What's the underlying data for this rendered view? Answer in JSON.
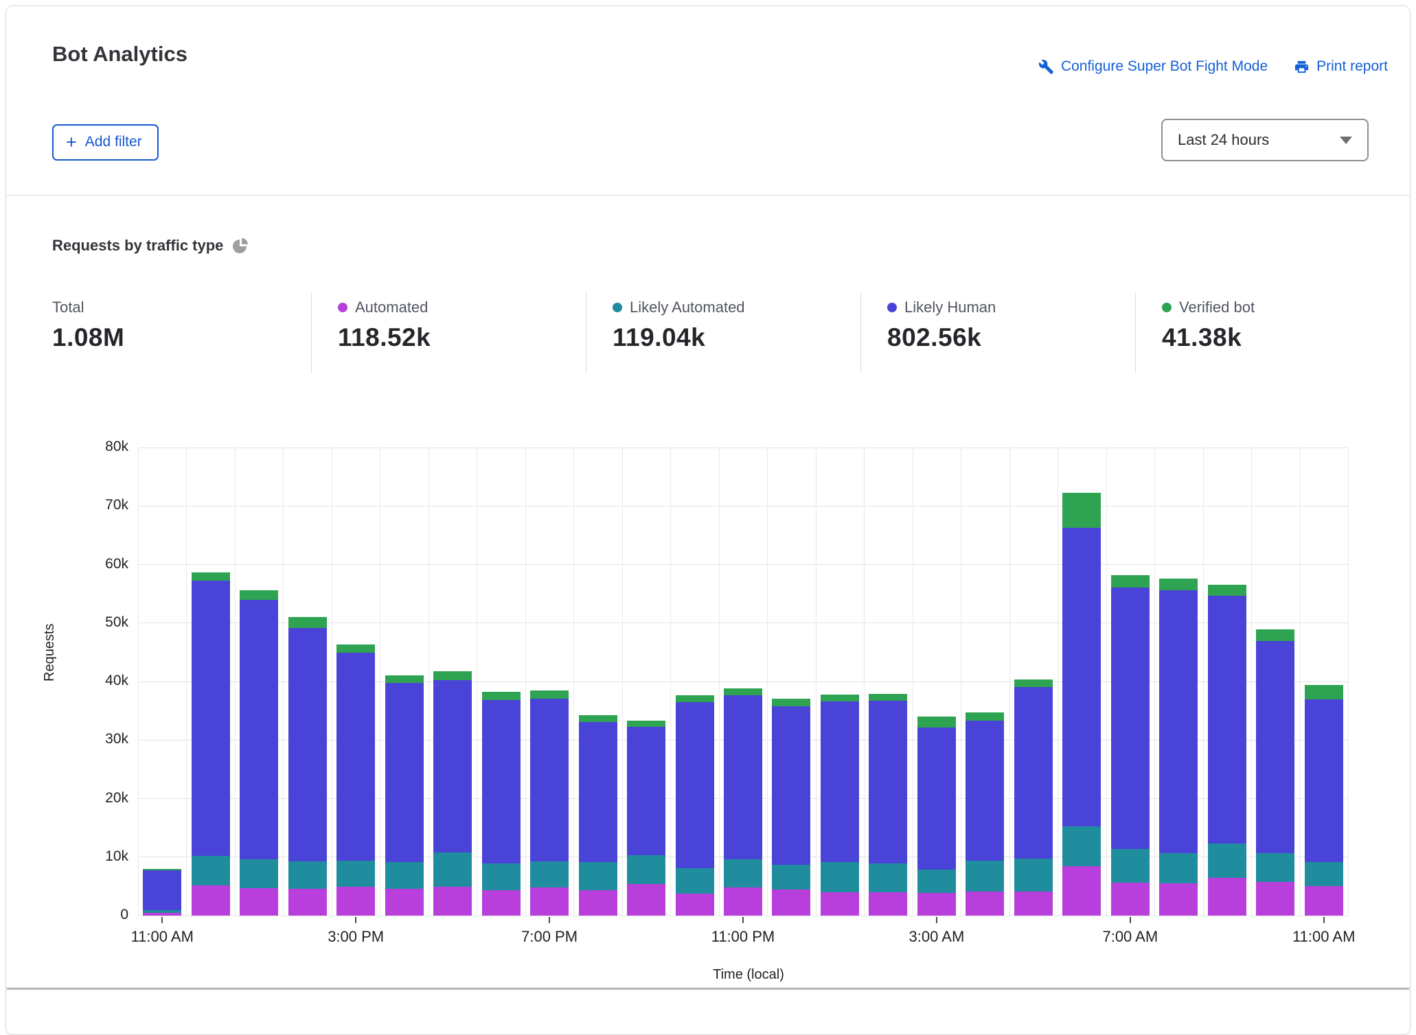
{
  "header": {
    "title": "Bot Analytics",
    "configure_link": "Configure Super Bot Fight Mode",
    "print_link": "Print report",
    "add_filter_label": "Add filter",
    "time_range_value": "Last 24 hours"
  },
  "section": {
    "title": "Requests by traffic type"
  },
  "stats": {
    "items": [
      {
        "label": "Total",
        "value": "1.08M",
        "color": null
      },
      {
        "label": "Automated",
        "value": "118.52k",
        "color": "#b83fdc"
      },
      {
        "label": "Likely Automated",
        "value": "119.04k",
        "color": "#1f8d9e"
      },
      {
        "label": "Likely Human",
        "value": "802.56k",
        "color": "#4a43d8"
      },
      {
        "label": "Verified bot",
        "value": "41.38k",
        "color": "#2ea352"
      }
    ]
  },
  "chart_data": {
    "type": "bar",
    "stacked": true,
    "title": "Requests by traffic type",
    "xlabel": "Time (local)",
    "ylabel": "Requests",
    "ylim": [
      0,
      80000
    ],
    "grid": true,
    "y_tick_labels": [
      "0",
      "10k",
      "20k",
      "30k",
      "40k",
      "50k",
      "60k",
      "70k",
      "80k"
    ],
    "x_tick_positions": [
      0,
      4,
      8,
      12,
      16,
      20,
      24
    ],
    "x_tick_labels": [
      "11:00 AM",
      "3:00 PM",
      "7:00 PM",
      "11:00 PM",
      "3:00 AM",
      "7:00 AM",
      "11:00 AM"
    ],
    "series_names": [
      "Automated",
      "Likely Automated",
      "Likely Human",
      "Verified bot"
    ],
    "colors": {
      "automated": "#b83fdc",
      "likely_automated": "#1f8d9e",
      "likely_human": "#4a43d8",
      "verified_bot": "#2ea352"
    },
    "bars": [
      {
        "time": "11:00 AM",
        "automated": 500,
        "likely_automated": 500,
        "likely_human": 6700,
        "verified_bot": 300
      },
      {
        "time": "12:00 PM",
        "automated": 5200,
        "likely_automated": 5000,
        "likely_human": 47000,
        "verified_bot": 1400
      },
      {
        "time": "1:00 PM",
        "automated": 4700,
        "likely_automated": 4900,
        "likely_human": 44400,
        "verified_bot": 1600
      },
      {
        "time": "2:00 PM",
        "automated": 4600,
        "likely_automated": 4700,
        "likely_human": 39900,
        "verified_bot": 1800
      },
      {
        "time": "3:00 PM",
        "automated": 4900,
        "likely_automated": 4500,
        "likely_human": 35500,
        "verified_bot": 1400
      },
      {
        "time": "4:00 PM",
        "automated": 4600,
        "likely_automated": 4600,
        "likely_human": 30600,
        "verified_bot": 1300
      },
      {
        "time": "5:00 PM",
        "automated": 4900,
        "likely_automated": 5900,
        "likely_human": 29400,
        "verified_bot": 1600
      },
      {
        "time": "6:00 PM",
        "automated": 4400,
        "likely_automated": 4500,
        "likely_human": 27900,
        "verified_bot": 1400
      },
      {
        "time": "7:00 PM",
        "automated": 4800,
        "likely_automated": 4500,
        "likely_human": 27800,
        "verified_bot": 1400
      },
      {
        "time": "8:00 PM",
        "automated": 4400,
        "likely_automated": 4800,
        "likely_human": 23900,
        "verified_bot": 1100
      },
      {
        "time": "9:00 PM",
        "automated": 5400,
        "likely_automated": 4900,
        "likely_human": 22000,
        "verified_bot": 1000
      },
      {
        "time": "10:00 PM",
        "automated": 3800,
        "likely_automated": 4300,
        "likely_human": 28400,
        "verified_bot": 1200
      },
      {
        "time": "11:00 PM",
        "automated": 4800,
        "likely_automated": 4800,
        "likely_human": 28100,
        "verified_bot": 1100
      },
      {
        "time": "12:00 AM",
        "automated": 4500,
        "likely_automated": 4200,
        "likely_human": 27100,
        "verified_bot": 1300
      },
      {
        "time": "1:00 AM",
        "automated": 4000,
        "likely_automated": 5100,
        "likely_human": 27500,
        "verified_bot": 1200
      },
      {
        "time": "2:00 AM",
        "automated": 4000,
        "likely_automated": 4900,
        "likely_human": 27800,
        "verified_bot": 1200
      },
      {
        "time": "3:00 AM",
        "automated": 3900,
        "likely_automated": 4000,
        "likely_human": 24300,
        "verified_bot": 1800
      },
      {
        "time": "4:00 AM",
        "automated": 4100,
        "likely_automated": 5300,
        "likely_human": 23900,
        "verified_bot": 1400
      },
      {
        "time": "5:00 AM",
        "automated": 4100,
        "likely_automated": 5600,
        "likely_human": 29400,
        "verified_bot": 1300
      },
      {
        "time": "6:00 AM",
        "automated": 8500,
        "likely_automated": 6700,
        "likely_human": 51100,
        "verified_bot": 6000
      },
      {
        "time": "7:00 AM",
        "automated": 5600,
        "likely_automated": 5800,
        "likely_human": 44700,
        "verified_bot": 2100
      },
      {
        "time": "8:00 AM",
        "automated": 5500,
        "likely_automated": 5200,
        "likely_human": 44900,
        "verified_bot": 2000
      },
      {
        "time": "9:00 AM",
        "automated": 6400,
        "likely_automated": 5900,
        "likely_human": 42400,
        "verified_bot": 1900
      },
      {
        "time": "10:00 AM",
        "automated": 5800,
        "likely_automated": 4900,
        "likely_human": 36200,
        "verified_bot": 2000
      },
      {
        "time": "11:00 AM",
        "automated": 5000,
        "likely_automated": 4100,
        "likely_human": 27900,
        "verified_bot": 2400
      }
    ]
  }
}
